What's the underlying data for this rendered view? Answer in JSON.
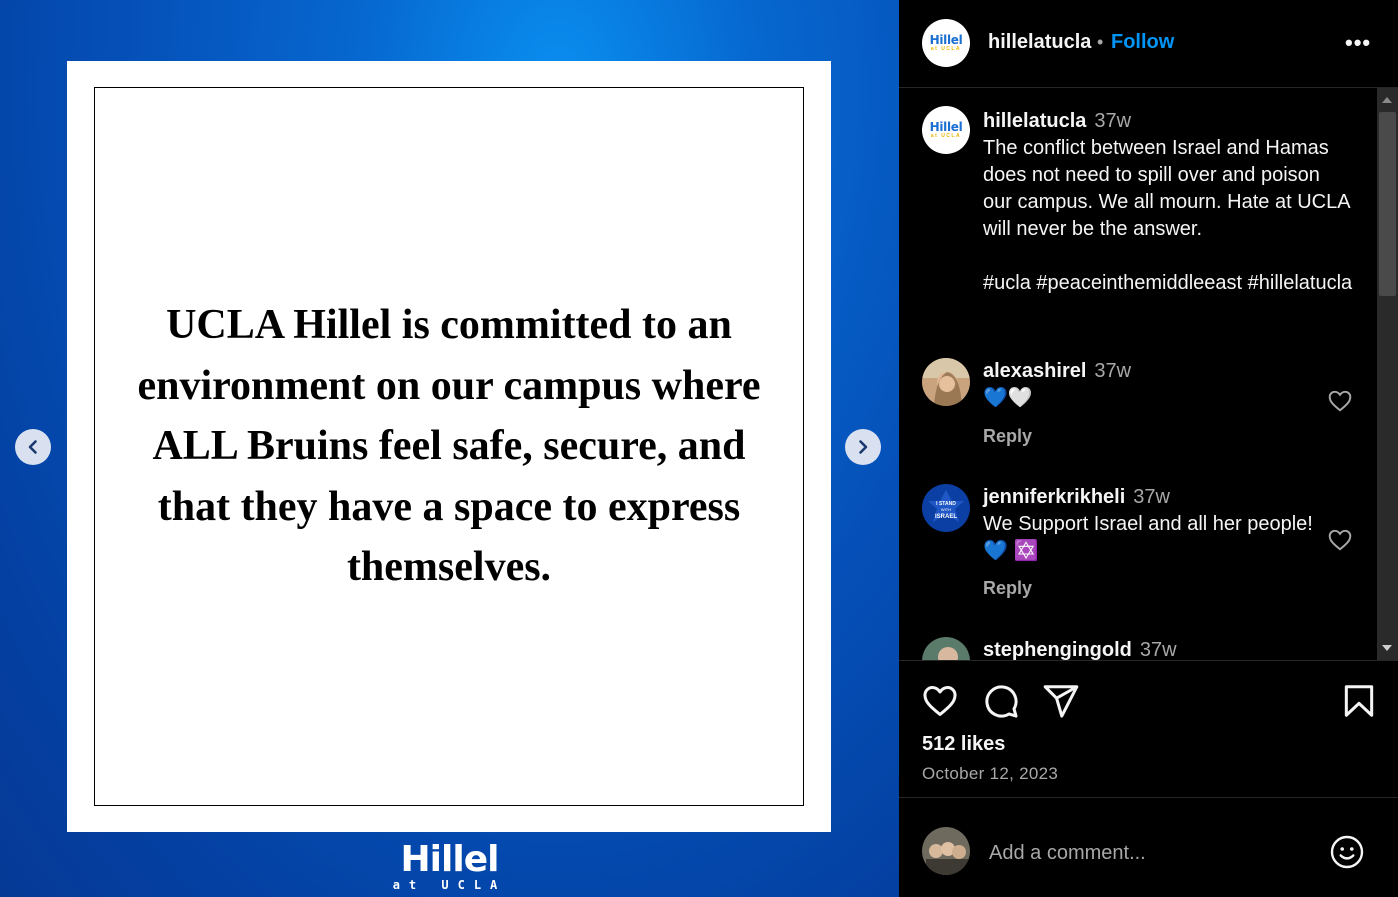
{
  "post": {
    "image_text": "UCLA Hillel is committed to an environment on our campus where ALL Bruins feel safe, secure, and that they have a space to express themselves.",
    "logo_main": "Hillel",
    "logo_sub": "at UCLA"
  },
  "header": {
    "username": "hillelatucla",
    "separator": "•",
    "follow_label": "Follow",
    "more_label": "•••",
    "avatar_main": "Hillel",
    "avatar_sub": "at UCLA"
  },
  "caption": {
    "username": "hillelatucla",
    "time": "37w",
    "text": "The conflict between Israel and Hamas does not need to spill over and poison our campus. We all mourn. Hate at UCLA will never be the answer.\n\n#ucla #peaceinthemiddleeast #hillelatucla"
  },
  "comments": [
    {
      "username": "alexashirel",
      "time": "37w",
      "text": "💙🤍",
      "reply_label": "Reply"
    },
    {
      "username": "jenniferkrikheli",
      "time": "37w",
      "text": "We Support Israel and all her people! 💙 ✡️",
      "reply_label": "Reply",
      "avatar_text": "I STAND WITH ISRAEL"
    },
    {
      "username": "stephengingold",
      "time": "37w"
    }
  ],
  "actions": {
    "icons": [
      "heart-icon",
      "comment-icon",
      "share-icon",
      "bookmark-icon"
    ]
  },
  "likes": "512 likes",
  "date": "October 12, 2023",
  "add_comment": {
    "placeholder": "Add a comment..."
  },
  "colors": {
    "accent": "#0095f6",
    "media_bg": "#0550b8",
    "panel_bg": "#000000"
  }
}
